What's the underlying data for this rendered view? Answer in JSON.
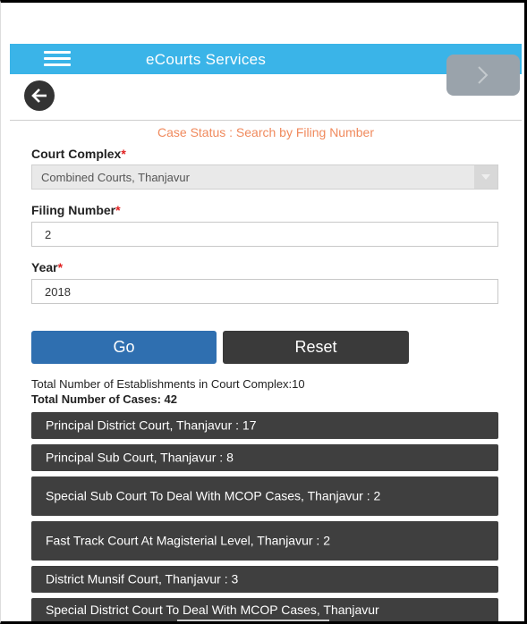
{
  "app": {
    "title": "eCourts Services"
  },
  "form": {
    "subtitle": "Case Status : Search by Filing Number",
    "court_complex_label": "Court Complex",
    "court_complex_value": "Combined Courts, Thanjavur",
    "filing_number_label": "Filing Number",
    "filing_number_value": "2",
    "year_label": "Year",
    "year_value": "2018",
    "required_mark": "*",
    "go_label": "Go",
    "reset_label": "Reset"
  },
  "results": {
    "establishments_text": "Total Number of Establishments in Court Complex:10",
    "cases_text": "Total Number of Cases: 42",
    "courts": [
      "Principal District Court, Thanjavur : 17",
      "Principal Sub Court, Thanjavur : 8",
      "Special Sub Court To Deal With MCOP Cases, Thanjavur : 2",
      "Fast Track Court At Magisterial Level, Thanjavur : 2",
      "District Munsif Court, Thanjavur : 3",
      "Special District Court To Deal With MCOP Cases, Thanjavur"
    ]
  },
  "colors": {
    "app_bar": "#3ab4e8",
    "subtitle": "#f08a5d",
    "required": "#e02020",
    "go_button": "#2f6fb0",
    "reset_button": "#3a3a3a",
    "court_item": "#3f3f3f"
  },
  "icons": {
    "menu": "hamburger-menu-icon",
    "back": "arrow-left-icon",
    "next": "chevron-right-icon",
    "dropdown": "chevron-down-icon"
  }
}
